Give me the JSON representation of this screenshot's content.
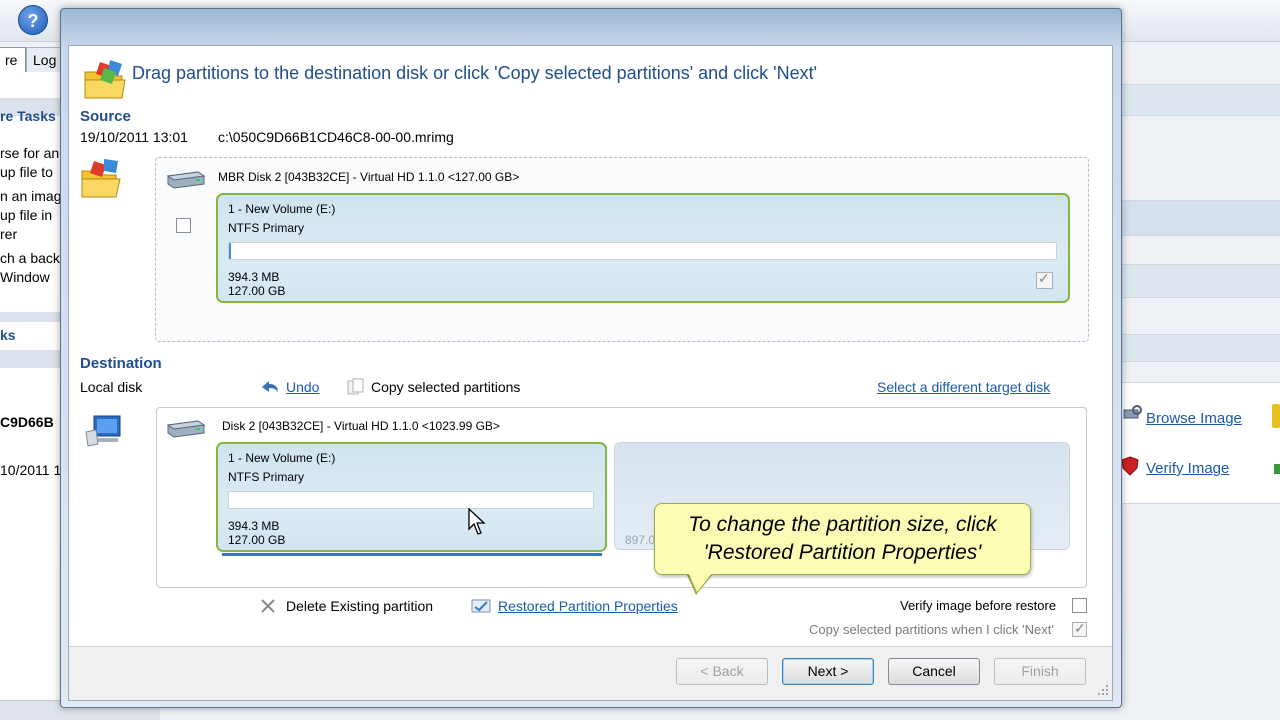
{
  "background_app": {
    "tabs": [
      "re",
      "Log"
    ],
    "left_panel": {
      "section1_title": "re Tasks",
      "items": [
        "rse for an",
        "up file to",
        "n an imag",
        "up file in",
        "rer",
        "ch a back",
        " Window"
      ],
      "section2_title": "ks",
      "backup_id": "C9D66B",
      "backup_date": "10/2011 1"
    },
    "right_panel": {
      "browse_image": "Browse Image",
      "verify_image": "Verify Image"
    }
  },
  "dialog": {
    "heading": "Drag partitions to the destination disk or click 'Copy selected partitions' and click 'Next'",
    "source": {
      "title": "Source",
      "date": "19/10/2011 13:01",
      "file": "c:\\050C9D66B1CD46C8-00-00.mrimg",
      "disk_label": "MBR Disk 2 [043B32CE] - Virtual HD 1.1.0  <127.00 GB>",
      "partition": {
        "name": "1 - New Volume (E:)",
        "type": "NTFS Primary",
        "used": "394.3 MB",
        "size": "127.00 GB",
        "used_fraction": 0.003
      }
    },
    "destination": {
      "title": "Destination",
      "subtitle": "Local disk",
      "undo": "Undo",
      "copy_selected": "Copy selected partitions",
      "select_target": "Select a different target disk",
      "disk_label": "Disk 2 [043B32CE] - Virtual HD 1.1.0  <1023.99 GB>",
      "partition": {
        "name": "1 - New Volume (E:)",
        "type": "NTFS Primary",
        "used": "394.3 MB",
        "size": "127.00 GB"
      },
      "unallocated_partial": "897.0"
    },
    "actions": {
      "delete_partition": "Delete Existing partition",
      "restored_properties": "Restored Partition Properties",
      "verify_before_restore": "Verify image before restore",
      "copy_on_next": "Copy selected partitions when I click 'Next'"
    },
    "callout": {
      "line1": "To change the partition size, click",
      "line2": "'Restored Partition Properties'"
    },
    "buttons": {
      "back": "< Back",
      "next": "Next >",
      "cancel": "Cancel",
      "finish": "Finish"
    }
  }
}
